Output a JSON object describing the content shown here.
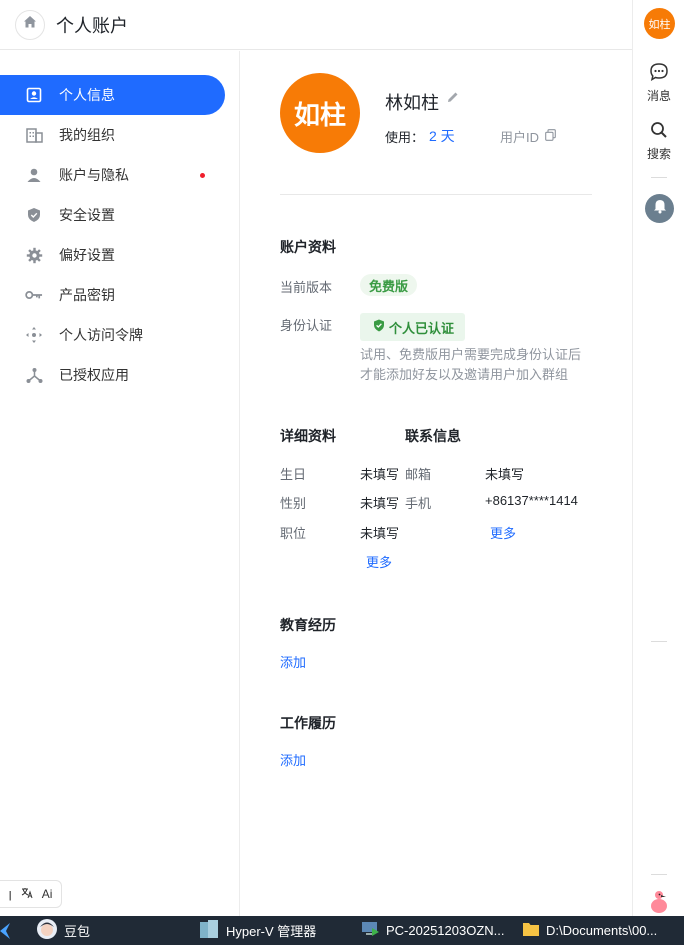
{
  "header": {
    "title": "个人账户"
  },
  "sidebar": {
    "items": [
      {
        "label": "个人信息",
        "icon": "profile-card-icon"
      },
      {
        "label": "我的组织",
        "icon": "building-icon"
      },
      {
        "label": "账户与隐私",
        "icon": "person-icon"
      },
      {
        "label": "安全设置",
        "icon": "shield-icon"
      },
      {
        "label": "偏好设置",
        "icon": "gear-icon"
      },
      {
        "label": "产品密钥",
        "icon": "key-icon"
      },
      {
        "label": "个人访问令牌",
        "icon": "token-icon"
      },
      {
        "label": "已授权应用",
        "icon": "share-node-icon"
      }
    ],
    "mini_toolbar": {
      "ai_label": "Ai"
    }
  },
  "profile": {
    "avatar_text": "如柱",
    "name": "林如柱",
    "usage_label": "使用：",
    "usage_value": "2 天",
    "user_id_label": "用户ID"
  },
  "account": {
    "title": "账户资料",
    "edition_label": "当前版本",
    "edition_value": "免费版",
    "identity_label": "身份认证",
    "identity_value": "个人已认证",
    "identity_note": "试用、免费版用户需要完成身份认证后才能添加好友以及邀请用户加入群组"
  },
  "details": {
    "title": "详细资料",
    "birthday_label": "生日",
    "birthday_value": "未填写",
    "gender_label": "性别",
    "gender_value": "未填写",
    "position_label": "职位",
    "position_value": "未填写",
    "more": "更多"
  },
  "contact": {
    "title": "联系信息",
    "email_label": "邮箱",
    "email_value": "未填写",
    "phone_label": "手机",
    "phone_value": "+86137****1414",
    "more": "更多"
  },
  "education": {
    "title": "教育经历",
    "add": "添加"
  },
  "work": {
    "title": "工作履历",
    "add": "添加"
  },
  "rail": {
    "avatar_text": "如柱",
    "messages": "消息",
    "search": "搜索"
  },
  "taskbar": {
    "items": [
      "豆包",
      "Hyper-V 管理器",
      "PC-20251203OZN...",
      "D:\\Documents\\00..."
    ]
  },
  "colors": {
    "accent": "#1f6bff",
    "avatar": "#f77b06",
    "taskbar": "#202a36"
  }
}
